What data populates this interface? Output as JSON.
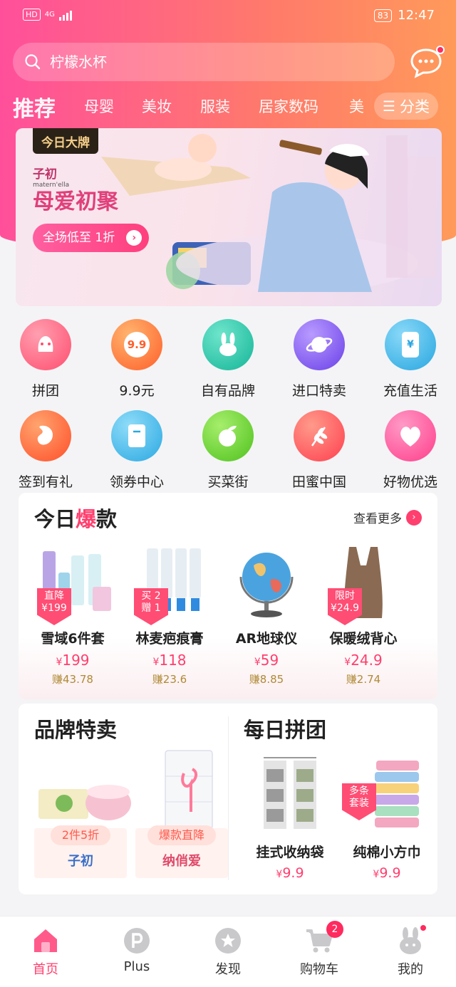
{
  "status_bar": {
    "network": "HD",
    "network_sub": "4G",
    "battery": "83",
    "time": "12:47"
  },
  "search": {
    "placeholder": "柠檬水杯"
  },
  "category_tabs": [
    {
      "label": "推荐",
      "active": true
    },
    {
      "label": "母婴"
    },
    {
      "label": "美妆"
    },
    {
      "label": "服装"
    },
    {
      "label": "居家数码"
    },
    {
      "label": "美"
    }
  ],
  "category_more": "分类",
  "banner": {
    "tag": "今日大牌",
    "brand": "子初",
    "brand_sub": "matern'ella",
    "title": "母爱初聚",
    "cta": "全场低至 1折"
  },
  "grid": [
    {
      "label": "拼团",
      "icon": "group-buy-icon",
      "color": "#ff5a7a"
    },
    {
      "label": "9.9元",
      "icon": "nine-nine-icon",
      "color": "#ff7a3c",
      "icon_text": "9.9"
    },
    {
      "label": "自有品牌",
      "icon": "rabbit-icon",
      "color": "#22c7a9"
    },
    {
      "label": "进口特卖",
      "icon": "planet-icon",
      "color": "#8a5cf0"
    },
    {
      "label": "充值生活",
      "icon": "phone-icon",
      "color": "#3ab8e8",
      "icon_text": "¥"
    },
    {
      "label": "签到有礼",
      "icon": "bean-icon",
      "color": "#ff6a3c"
    },
    {
      "label": "领券中心",
      "icon": "coupon-icon",
      "color": "#40b7ea"
    },
    {
      "label": "买菜街",
      "icon": "fruit-icon",
      "color": "#6ccf3a"
    },
    {
      "label": "田蜜中国",
      "icon": "wheat-icon",
      "color": "#ff5460"
    },
    {
      "label": "好物优选",
      "icon": "heart-icon",
      "color": "#ff5a9a"
    }
  ],
  "hot": {
    "title_prefix": "今日",
    "title_highlight": "爆",
    "title_suffix": "款",
    "see_more": "查看更多",
    "products": [
      {
        "name": "雪域6件套",
        "currency": "¥",
        "price": "199",
        "earn": "赚43.78",
        "tag_line1": "直降",
        "tag_line2": "¥199",
        "image": "skincare-set-icon"
      },
      {
        "name": "林麦疤痕膏",
        "currency": "¥",
        "price": "118",
        "earn": "赚23.6",
        "tag_line1": "买 2",
        "tag_line2": "赠 1",
        "image": "cream-tubes-icon"
      },
      {
        "name": "AR地球仪",
        "currency": "¥",
        "price": "59",
        "earn": "赚8.85",
        "image": "globe-icon"
      },
      {
        "name": "保暖绒背心",
        "currency": "¥",
        "price": "24.9",
        "earn": "赚2.74",
        "tag_line1": "限时",
        "tag_line2": "¥24.9",
        "image": "vest-icon"
      }
    ]
  },
  "brand_sale": {
    "title": "品牌特卖",
    "items": [
      {
        "pill": "2件5折",
        "logo": "子初"
      },
      {
        "pill": "爆款直降",
        "logo": "纳俏爱"
      }
    ]
  },
  "daily_group": {
    "title": "每日拼团",
    "items": [
      {
        "name": "挂式收纳袋",
        "currency": "¥",
        "price": "9.9"
      },
      {
        "name": "纯棉小方巾",
        "currency": "¥",
        "price": "9.9",
        "tag_line1": "多条",
        "tag_line2": "套装"
      }
    ]
  },
  "bottom_nav": [
    {
      "label": "首页",
      "icon": "home-icon",
      "active": true
    },
    {
      "label": "Plus",
      "icon": "plus-p-icon"
    },
    {
      "label": "发现",
      "icon": "star-icon"
    },
    {
      "label": "购物车",
      "icon": "cart-icon",
      "badge": "2"
    },
    {
      "label": "我的",
      "icon": "profile-rabbit-icon"
    }
  ]
}
